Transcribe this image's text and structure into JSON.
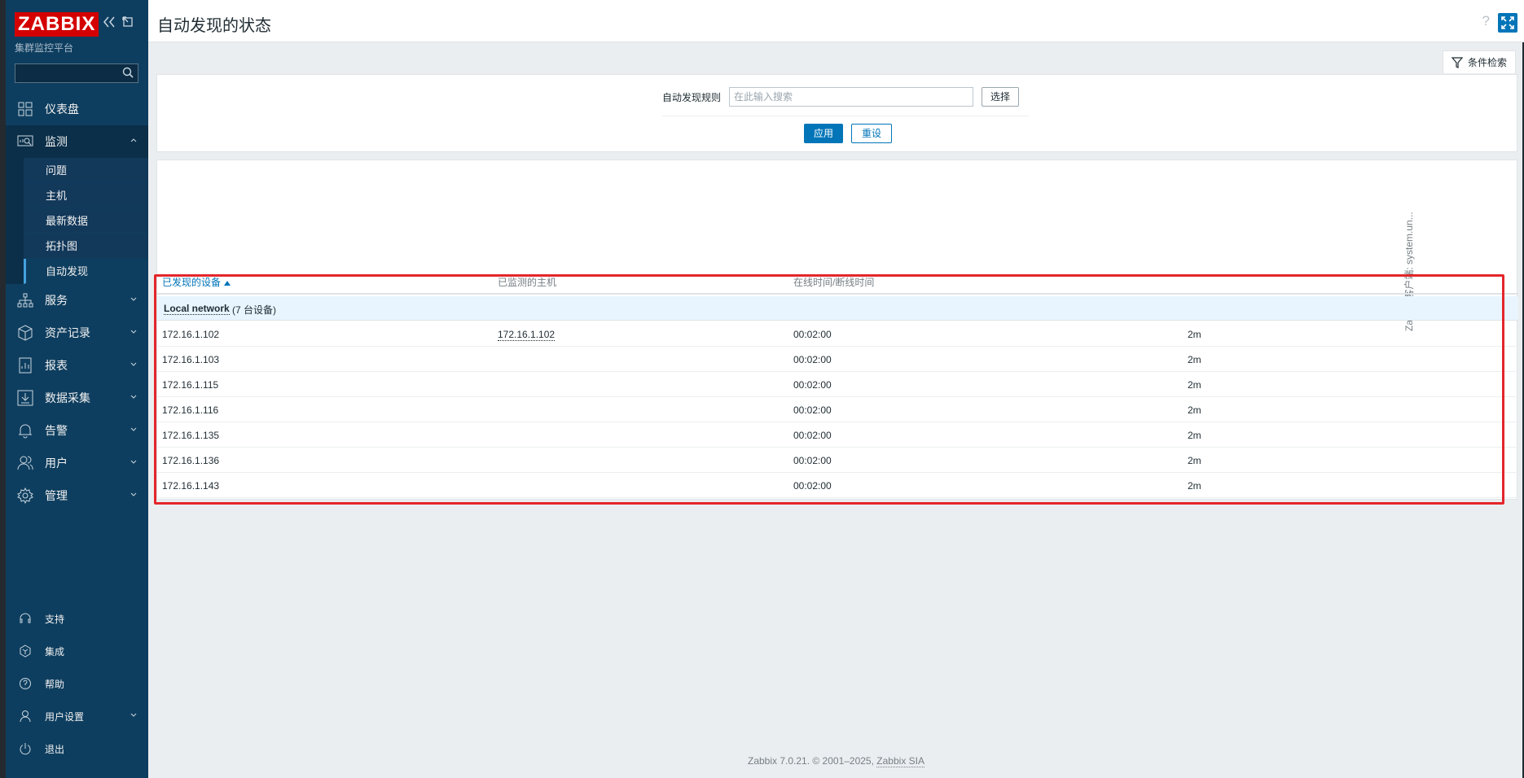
{
  "brand": {
    "logo": "ZABBIX",
    "subtitle": "集群监控平台"
  },
  "sidebar": {
    "search_placeholder": "",
    "items": [
      {
        "label": "仪表盘",
        "icon": "dashboard-icon"
      },
      {
        "label": "监测",
        "icon": "monitoring-icon",
        "expanded": true,
        "children": [
          "问题",
          "主机",
          "最新数据",
          "拓扑图",
          "自动发现"
        ],
        "current": "自动发现"
      },
      {
        "label": "服务",
        "icon": "services-icon"
      },
      {
        "label": "资产记录",
        "icon": "inventory-icon"
      },
      {
        "label": "报表",
        "icon": "reports-icon"
      },
      {
        "label": "数据采集",
        "icon": "data-collection-icon"
      },
      {
        "label": "告警",
        "icon": "alerts-icon"
      },
      {
        "label": "用户",
        "icon": "users-icon"
      },
      {
        "label": "管理",
        "icon": "administration-icon"
      }
    ],
    "bottom": [
      {
        "label": "支持",
        "icon": "support-icon"
      },
      {
        "label": "集成",
        "icon": "integrations-icon"
      },
      {
        "label": "帮助",
        "icon": "help-icon"
      },
      {
        "label": "用户设置",
        "icon": "user-settings-icon"
      },
      {
        "label": "退出",
        "icon": "signout-icon"
      }
    ]
  },
  "header": {
    "title": "自动发现的状态",
    "help": "?"
  },
  "filter": {
    "tab_label": "条件检索",
    "rule_label": "自动发现规则",
    "rule_placeholder": "在此输入搜索",
    "select_label": "选择",
    "apply_label": "应用",
    "reset_label": "重设"
  },
  "table": {
    "vertical_header": "Zabbix 客户端: system.un...",
    "columns": [
      "已发现的设备",
      "已监测的主机",
      "在线时间/断线时间"
    ],
    "group": {
      "name": "Local network",
      "count": "(7 台设备)"
    },
    "rows": [
      {
        "device": "172.16.1.102",
        "host": "172.16.1.102",
        "uptime": "00:02:00",
        "value": "2m"
      },
      {
        "device": "172.16.1.103",
        "host": "",
        "uptime": "00:02:00",
        "value": "2m"
      },
      {
        "device": "172.16.1.115",
        "host": "",
        "uptime": "00:02:00",
        "value": "2m"
      },
      {
        "device": "172.16.1.116",
        "host": "",
        "uptime": "00:02:00",
        "value": "2m"
      },
      {
        "device": "172.16.1.135",
        "host": "",
        "uptime": "00:02:00",
        "value": "2m"
      },
      {
        "device": "172.16.1.136",
        "host": "",
        "uptime": "00:02:00",
        "value": "2m"
      },
      {
        "device": "172.16.1.143",
        "host": "",
        "uptime": "00:02:00",
        "value": "2m"
      }
    ]
  },
  "footer": {
    "text": "Zabbix 7.0.21. © 2001–2025,",
    "link": "Zabbix SIA"
  }
}
